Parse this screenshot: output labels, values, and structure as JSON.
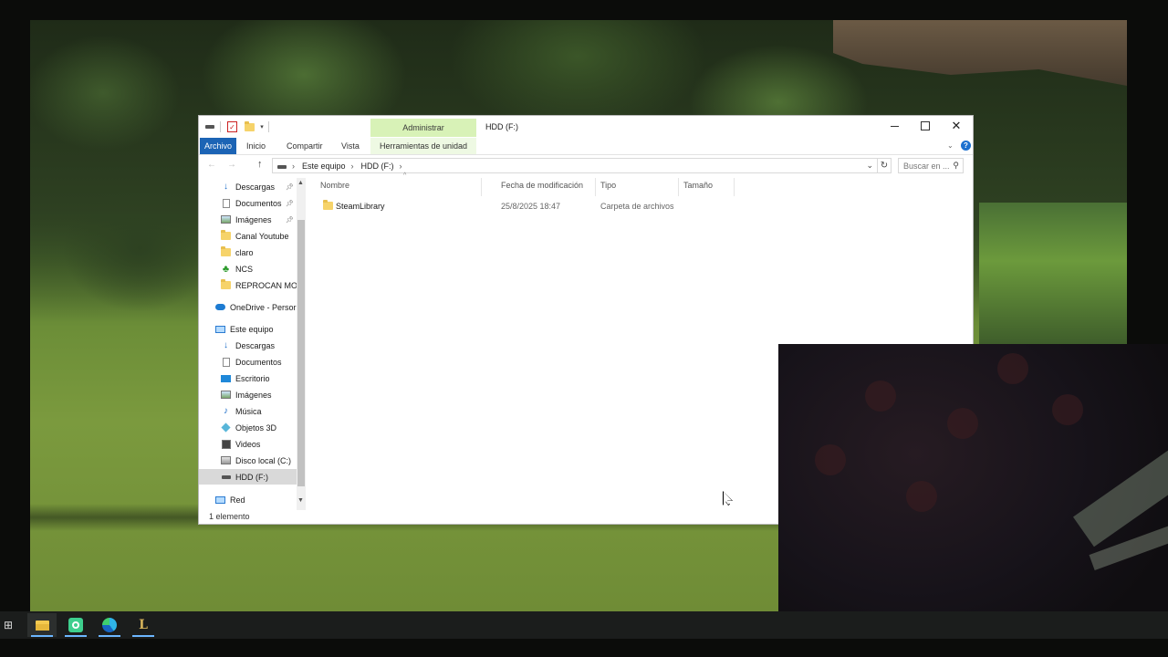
{
  "window": {
    "title": "HDD (F:)",
    "context_tab_header": "Administrar",
    "controls": {
      "minimize": "minimize",
      "maximize": "maximize",
      "close": "✕"
    }
  },
  "ribbon": {
    "tabs": [
      "Archivo",
      "Inicio",
      "Compartir",
      "Vista",
      "Herramientas de unidad"
    ],
    "active_tab_color": "#1c64b5",
    "context_color": "#d8f2b7",
    "help_label": "?"
  },
  "address": {
    "breadcrumbs": [
      "Este equipo",
      "HDD (F:)"
    ],
    "search_placeholder": "Buscar en ..."
  },
  "nav_pane": {
    "quick_access": [
      {
        "label": "Descargas",
        "icon": "download-icon",
        "pinned": true
      },
      {
        "label": "Documentos",
        "icon": "document-icon",
        "pinned": true
      },
      {
        "label": "Imágenes",
        "icon": "image-icon",
        "pinned": true
      },
      {
        "label": "Canal Youtube",
        "icon": "folder-icon",
        "pinned": false
      },
      {
        "label": "claro",
        "icon": "folder-icon",
        "pinned": false
      },
      {
        "label": "NCS",
        "icon": "tree-icon",
        "pinned": false
      },
      {
        "label": "REPROCAN MO",
        "icon": "folder-icon",
        "pinned": false
      }
    ],
    "onedrive": "OneDrive - Persor",
    "this_pc": "Este equipo",
    "this_pc_items": [
      {
        "label": "Descargas",
        "icon": "download-icon"
      },
      {
        "label": "Documentos",
        "icon": "document-icon"
      },
      {
        "label": "Escritorio",
        "icon": "desktop-icon"
      },
      {
        "label": "Imágenes",
        "icon": "image-icon"
      },
      {
        "label": "Música",
        "icon": "music-icon"
      },
      {
        "label": "Objetos 3D",
        "icon": "objects-3d-icon"
      },
      {
        "label": "Videos",
        "icon": "video-icon"
      },
      {
        "label": "Disco local (C:)",
        "icon": "local-disk-icon"
      },
      {
        "label": "HDD (F:)",
        "icon": "drive-icon",
        "selected": true
      }
    ],
    "network": "Red"
  },
  "columns": [
    "Nombre",
    "Fecha de modificación",
    "Tipo",
    "Tamaño"
  ],
  "files": [
    {
      "name": "SteamLibrary",
      "modified": "25/8/2025 18:47",
      "type": "Carpeta de archivos",
      "size": ""
    }
  ],
  "status": {
    "item_count": "1 elemento"
  },
  "taskbar": {
    "apps": [
      "task-view-icon",
      "file-explorer-icon",
      "whatsapp-icon",
      "edge-icon",
      "league-of-legends-icon"
    ],
    "active_app": "file-explorer-icon",
    "lol_glyph": "L"
  }
}
